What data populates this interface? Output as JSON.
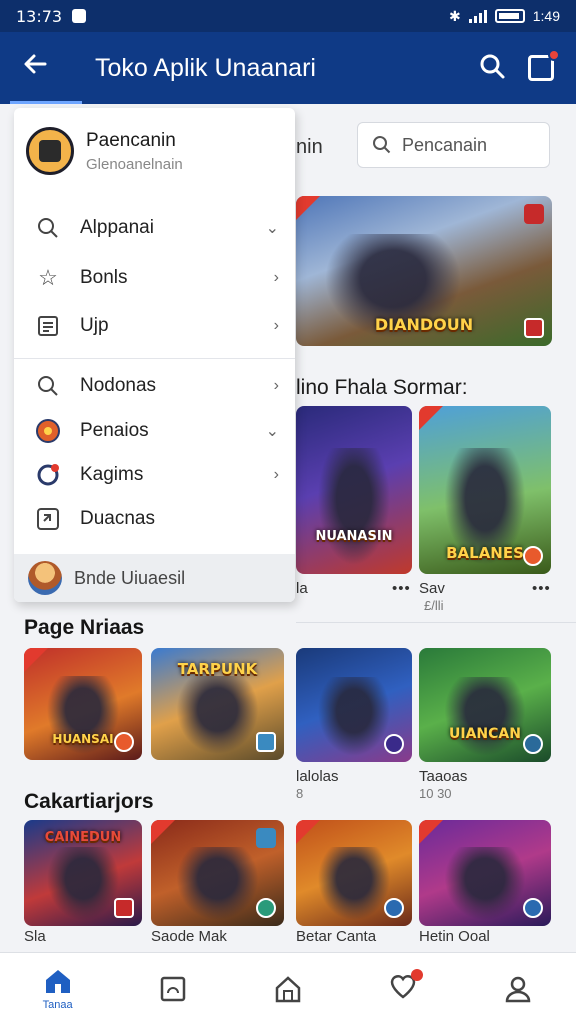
{
  "status": {
    "time": "13:73",
    "clock": "1:49"
  },
  "appbar": {
    "title": "Toko Aplik Unaanari"
  },
  "search": {
    "placeholder": "Pencanain"
  },
  "background": {
    "tab_label": "nin",
    "section_title": "lino Fhala Sormar:",
    "hero_word": "DIANDOUN",
    "tiles": [
      {
        "word": "NUANASIN",
        "caption": "la",
        "sub": ""
      },
      {
        "word": "BALANES",
        "caption": "Sav",
        "sub": "£/lli"
      },
      {
        "word": "",
        "caption": "lalolas",
        "sub": "8"
      },
      {
        "word": "UIANCAN",
        "caption": "Taaoas",
        "sub": "10 30"
      },
      {
        "word": "",
        "caption": "Betar Canta",
        "sub": ""
      },
      {
        "word": "",
        "caption": "Hetin Ooal",
        "sub": ""
      }
    ]
  },
  "drawer": {
    "profile": {
      "name": "Paencanin",
      "subtitle": "Glenoanelnain"
    },
    "items": [
      {
        "label": "Alppanai",
        "icon": "search-icon",
        "chev": "⌄"
      },
      {
        "label": "Bonls",
        "icon": "star-icon",
        "chev": "›"
      },
      {
        "label": "Ujp",
        "icon": "list-icon",
        "chev": "›"
      },
      {
        "label": "Nodonas",
        "icon": "search-icon",
        "chev": "›"
      },
      {
        "label": "Penaios",
        "icon": "circle-icon",
        "chev": "⌄"
      },
      {
        "label": "Kagims",
        "icon": "gamepad-icon",
        "chev": "›"
      },
      {
        "label": "Duacnas",
        "icon": "swap-icon",
        "chev": ""
      }
    ],
    "recent": {
      "label": "Bnde Uiuaesil"
    }
  },
  "left_sections": [
    {
      "title": "Page Nriaas",
      "tiles": [
        {
          "word": "HUANSAI",
          "caption": ""
        },
        {
          "word": "TARPUNK",
          "caption": ""
        }
      ]
    },
    {
      "title": "Cakartiarjors",
      "tiles": [
        {
          "word": "CAINEDUN",
          "caption": "Sla"
        },
        {
          "word": "",
          "caption": "Saode Mak"
        }
      ]
    }
  ],
  "bottomnav": {
    "home_label": "Tanaa"
  }
}
